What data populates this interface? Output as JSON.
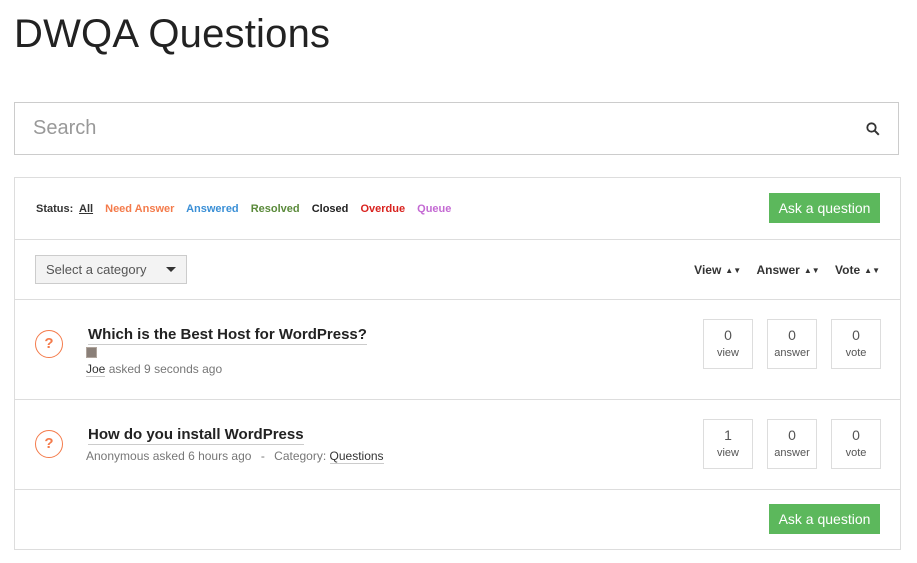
{
  "page": {
    "title": "DWQA Questions"
  },
  "search": {
    "placeholder": "Search",
    "icon": "search-icon"
  },
  "status": {
    "label": "Status:",
    "links": [
      {
        "label": "All",
        "color": "#333333",
        "active": true
      },
      {
        "label": "Need Answer",
        "color": "#f47b4b"
      },
      {
        "label": "Answered",
        "color": "#3a8fd6"
      },
      {
        "label": "Resolved",
        "color": "#5a8a3a"
      },
      {
        "label": "Closed",
        "color": "#222222"
      },
      {
        "label": "Overdue",
        "color": "#d9231f"
      },
      {
        "label": "Queue",
        "color": "#c46ad3"
      }
    ]
  },
  "actions": {
    "ask_label": "Ask a question",
    "ask_color": "#5cb85c"
  },
  "filter": {
    "category_selected": "Select a category",
    "sort": [
      {
        "label": "View"
      },
      {
        "label": "Answer"
      },
      {
        "label": "Vote"
      }
    ]
  },
  "questions": [
    {
      "title": "Which is the Best Host for WordPress?",
      "author": "Joe",
      "asked_text": "asked 9 seconds ago",
      "views": "0",
      "answers": "0",
      "votes": "0"
    },
    {
      "title": "How do you install WordPress",
      "author": "Anonymous",
      "asked_text": "asked 6 hours ago",
      "sep": "-",
      "category_label": "Category:",
      "category": "Questions",
      "views": "1",
      "answers": "0",
      "votes": "0"
    }
  ],
  "stat_labels": {
    "view": "view",
    "answer": "answer",
    "vote": "vote"
  },
  "icons": {
    "question_mark": "?",
    "sort_arrows": "▲▼"
  }
}
